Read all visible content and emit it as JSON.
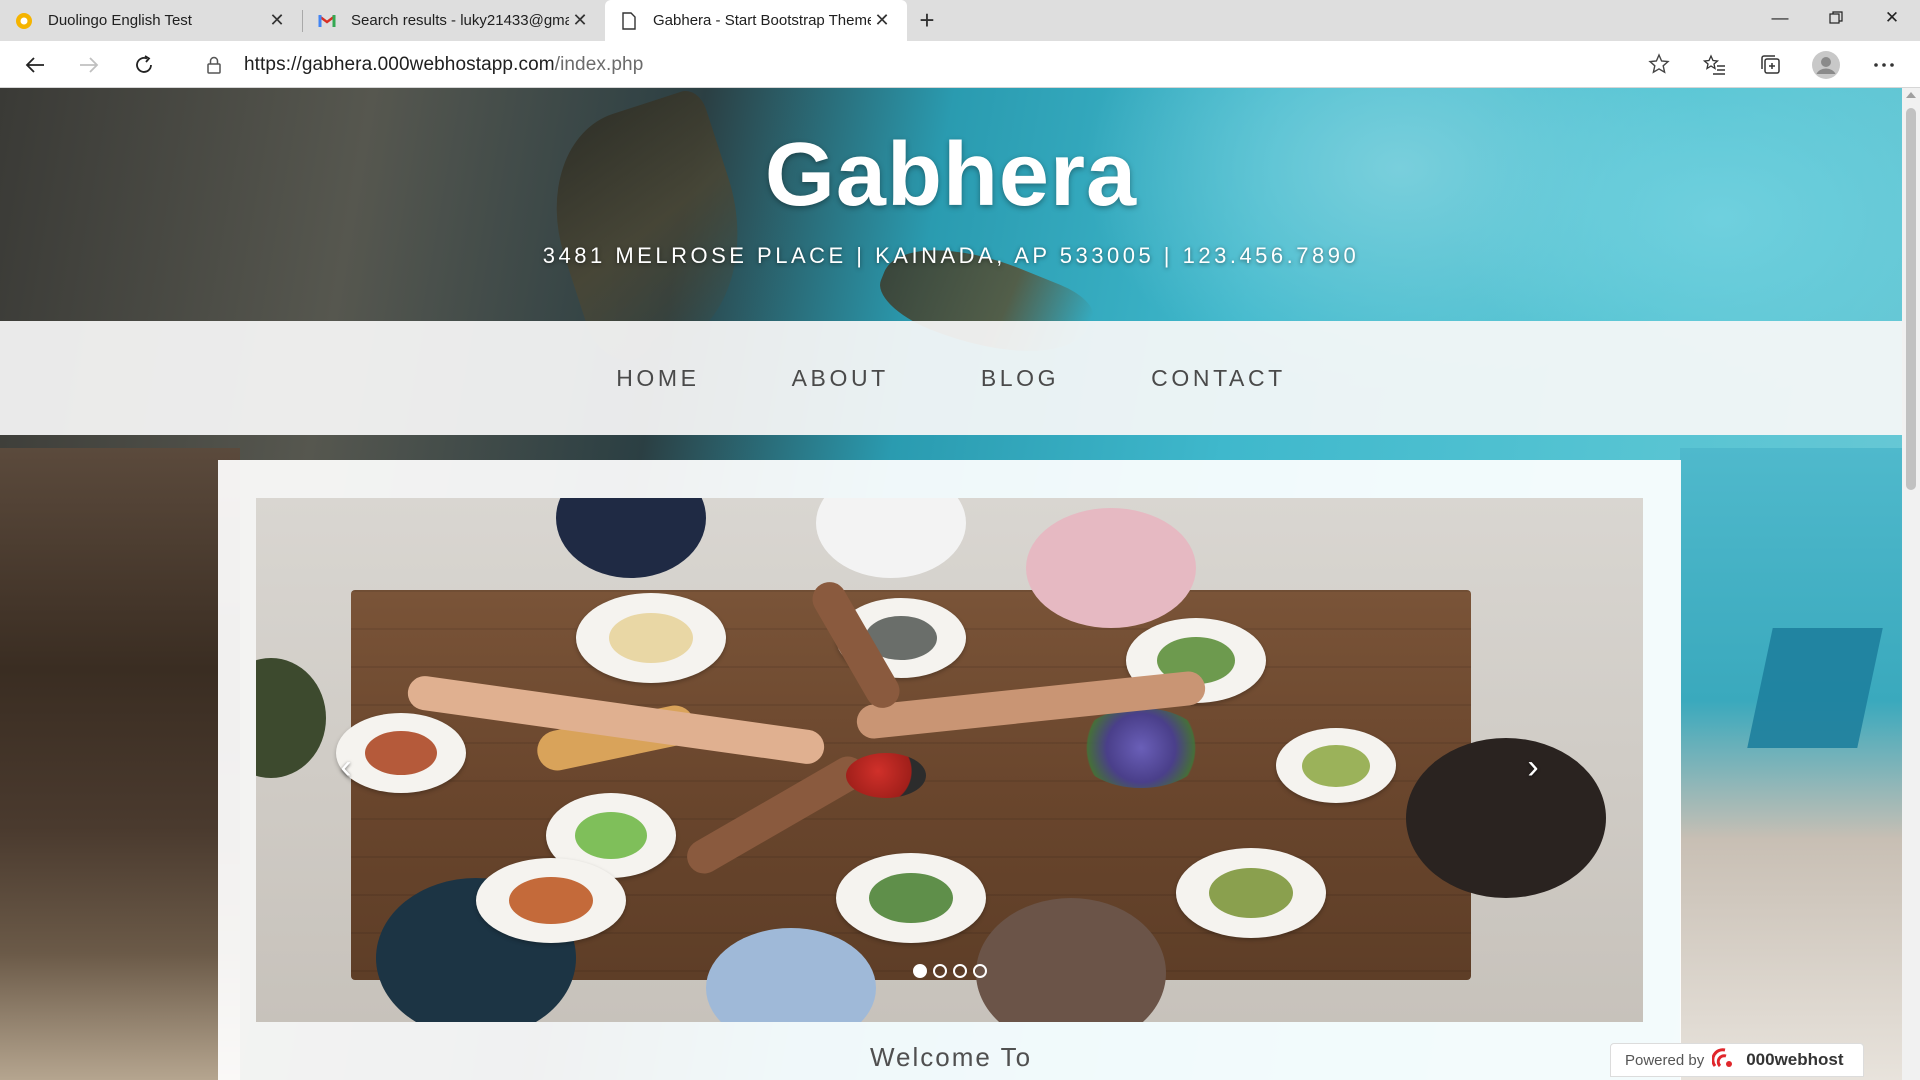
{
  "browser": {
    "tabs": [
      {
        "title": "Duolingo English Test",
        "favicon": "duolingo-icon",
        "active": false
      },
      {
        "title": "Search results - luky21433@gma",
        "favicon": "gmail-icon",
        "active": false
      },
      {
        "title": "Gabhera - Start Bootstrap Theme",
        "favicon": "page-icon",
        "active": true
      }
    ],
    "url": {
      "origin": "https://gabhera.000webhostapp.com",
      "path": "/index.php"
    }
  },
  "site": {
    "brand": "Gabhera",
    "address": "3481 Melrose Place | Kainada, AP 533005 | 123.456.7890",
    "nav": [
      "Home",
      "About",
      "Blog",
      "Contact"
    ],
    "carousel": {
      "prev_label": "‹",
      "next_label": "›",
      "slide_count": 4,
      "active_slide": 1
    },
    "welcome": "Welcome To"
  },
  "badge": {
    "prefix": "Powered by",
    "brand": "000webhost"
  },
  "colors": {
    "accent_teal": "#3fb8cc",
    "nav_text": "#4a4a4a",
    "badge_red": "#e0262b"
  }
}
